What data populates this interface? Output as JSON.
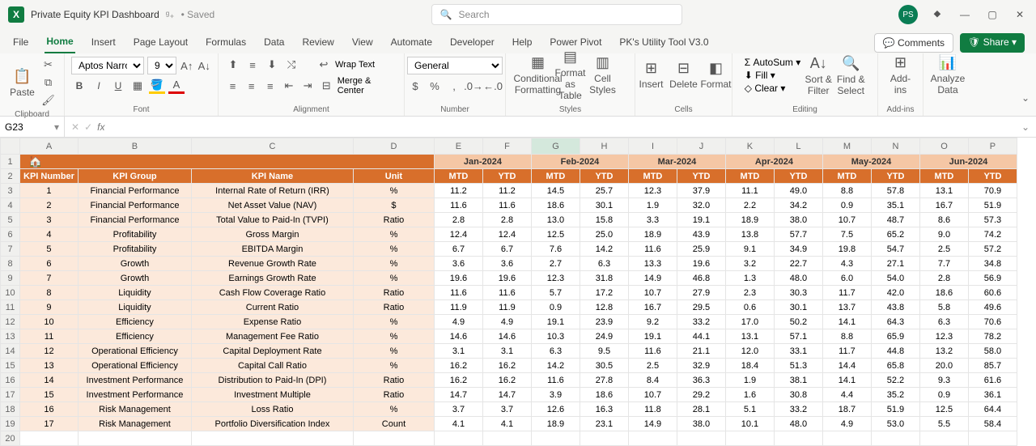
{
  "title": {
    "doc": "Private Equity KPI Dashboard",
    "saved": "• Saved",
    "search_ph": "Search",
    "avatar": "PS"
  },
  "tabs": {
    "items": [
      "File",
      "Home",
      "Insert",
      "Page Layout",
      "Formulas",
      "Data",
      "Review",
      "View",
      "Automate",
      "Developer",
      "Help",
      "Power Pivot",
      "PK's Utility Tool V3.0"
    ],
    "active": 1,
    "comments": "Comments",
    "share": "Share"
  },
  "ribbon": {
    "clipboard": "Clipboard",
    "font": "Font",
    "alignment": "Alignment",
    "number": "Number",
    "styles": "Styles",
    "cells": "Cells",
    "editing": "Editing",
    "addins": "Add-ins",
    "analyze": "Analyze Data",
    "font_name": "Aptos Narrow",
    "font_size": "9",
    "wrap": "Wrap Text",
    "merge": "Merge & Center",
    "num_fmt": "General",
    "cond": "Conditional Formatting",
    "fmt_table": "Format as Table",
    "cell_styles": "Cell Styles",
    "insert": "Insert",
    "delete": "Delete",
    "format": "Format",
    "autosum": "AutoSum",
    "fill": "Fill",
    "clear": "Clear",
    "sort": "Sort & Filter",
    "find": "Find & Select",
    "addins_btn": "Add-ins",
    "analyze_btn": "Analyze Data"
  },
  "fbar": {
    "cell": "G23"
  },
  "cols": [
    "A",
    "B",
    "C",
    "D",
    "E",
    "F",
    "G",
    "H",
    "I",
    "J",
    "K",
    "L",
    "M",
    "N",
    "O",
    "P"
  ],
  "months": [
    "Jan-2024",
    "Feb-2024",
    "Mar-2024",
    "Apr-2024",
    "May-2024",
    "Jun-2024"
  ],
  "hdr": {
    "num": "KPI Number",
    "grp": "KPI Group",
    "name": "KPI Name",
    "unit": "Unit",
    "mtd": "MTD",
    "ytd": "YTD"
  },
  "rows": [
    {
      "n": "1",
      "g": "Financial Performance",
      "k": "Internal Rate of Return (IRR)",
      "u": "%",
      "v": [
        "11.2",
        "11.2",
        "14.5",
        "25.7",
        "12.3",
        "37.9",
        "11.1",
        "49.0",
        "8.8",
        "57.8",
        "13.1",
        "70.9"
      ]
    },
    {
      "n": "2",
      "g": "Financial Performance",
      "k": "Net Asset Value (NAV)",
      "u": "$",
      "v": [
        "11.6",
        "11.6",
        "18.6",
        "30.1",
        "1.9",
        "32.0",
        "2.2",
        "34.2",
        "0.9",
        "35.1",
        "16.7",
        "51.9"
      ]
    },
    {
      "n": "3",
      "g": "Financial Performance",
      "k": "Total Value to Paid-In (TVPI)",
      "u": "Ratio",
      "v": [
        "2.8",
        "2.8",
        "13.0",
        "15.8",
        "3.3",
        "19.1",
        "18.9",
        "38.0",
        "10.7",
        "48.7",
        "8.6",
        "57.3"
      ]
    },
    {
      "n": "4",
      "g": "Profitability",
      "k": "Gross Margin",
      "u": "%",
      "v": [
        "12.4",
        "12.4",
        "12.5",
        "25.0",
        "18.9",
        "43.9",
        "13.8",
        "57.7",
        "7.5",
        "65.2",
        "9.0",
        "74.2"
      ]
    },
    {
      "n": "5",
      "g": "Profitability",
      "k": "EBITDA Margin",
      "u": "%",
      "v": [
        "6.7",
        "6.7",
        "7.6",
        "14.2",
        "11.6",
        "25.9",
        "9.1",
        "34.9",
        "19.8",
        "54.7",
        "2.5",
        "57.2"
      ]
    },
    {
      "n": "6",
      "g": "Growth",
      "k": "Revenue Growth Rate",
      "u": "%",
      "v": [
        "3.6",
        "3.6",
        "2.7",
        "6.3",
        "13.3",
        "19.6",
        "3.2",
        "22.7",
        "4.3",
        "27.1",
        "7.7",
        "34.8"
      ]
    },
    {
      "n": "7",
      "g": "Growth",
      "k": "Earnings Growth Rate",
      "u": "%",
      "v": [
        "19.6",
        "19.6",
        "12.3",
        "31.8",
        "14.9",
        "46.8",
        "1.3",
        "48.0",
        "6.0",
        "54.0",
        "2.8",
        "56.9"
      ]
    },
    {
      "n": "8",
      "g": "Liquidity",
      "k": "Cash Flow Coverage Ratio",
      "u": "Ratio",
      "v": [
        "11.6",
        "11.6",
        "5.7",
        "17.2",
        "10.7",
        "27.9",
        "2.3",
        "30.3",
        "11.7",
        "42.0",
        "18.6",
        "60.6"
      ]
    },
    {
      "n": "9",
      "g": "Liquidity",
      "k": "Current Ratio",
      "u": "Ratio",
      "v": [
        "11.9",
        "11.9",
        "0.9",
        "12.8",
        "16.7",
        "29.5",
        "0.6",
        "30.1",
        "13.7",
        "43.8",
        "5.8",
        "49.6"
      ]
    },
    {
      "n": "10",
      "g": "Efficiency",
      "k": "Expense Ratio",
      "u": "%",
      "v": [
        "4.9",
        "4.9",
        "19.1",
        "23.9",
        "9.2",
        "33.2",
        "17.0",
        "50.2",
        "14.1",
        "64.3",
        "6.3",
        "70.6"
      ]
    },
    {
      "n": "11",
      "g": "Efficiency",
      "k": "Management Fee Ratio",
      "u": "%",
      "v": [
        "14.6",
        "14.6",
        "10.3",
        "24.9",
        "19.1",
        "44.1",
        "13.1",
        "57.1",
        "8.8",
        "65.9",
        "12.3",
        "78.2"
      ]
    },
    {
      "n": "12",
      "g": "Operational Efficiency",
      "k": "Capital Deployment Rate",
      "u": "%",
      "v": [
        "3.1",
        "3.1",
        "6.3",
        "9.5",
        "11.6",
        "21.1",
        "12.0",
        "33.1",
        "11.7",
        "44.8",
        "13.2",
        "58.0"
      ]
    },
    {
      "n": "13",
      "g": "Operational Efficiency",
      "k": "Capital Call Ratio",
      "u": "%",
      "v": [
        "16.2",
        "16.2",
        "14.2",
        "30.5",
        "2.5",
        "32.9",
        "18.4",
        "51.3",
        "14.4",
        "65.8",
        "20.0",
        "85.7"
      ]
    },
    {
      "n": "14",
      "g": "Investment Performance",
      "k": "Distribution to Paid-In (DPI)",
      "u": "Ratio",
      "v": [
        "16.2",
        "16.2",
        "11.6",
        "27.8",
        "8.4",
        "36.3",
        "1.9",
        "38.1",
        "14.1",
        "52.2",
        "9.3",
        "61.6"
      ]
    },
    {
      "n": "15",
      "g": "Investment Performance",
      "k": "Investment Multiple",
      "u": "Ratio",
      "v": [
        "14.7",
        "14.7",
        "3.9",
        "18.6",
        "10.7",
        "29.2",
        "1.6",
        "30.8",
        "4.4",
        "35.2",
        "0.9",
        "36.1"
      ]
    },
    {
      "n": "16",
      "g": "Risk Management",
      "k": "Loss Ratio",
      "u": "%",
      "v": [
        "3.7",
        "3.7",
        "12.6",
        "16.3",
        "11.8",
        "28.1",
        "5.1",
        "33.2",
        "18.7",
        "51.9",
        "12.5",
        "64.4"
      ]
    },
    {
      "n": "17",
      "g": "Risk Management",
      "k": "Portfolio Diversification Index",
      "u": "Count",
      "v": [
        "4.1",
        "4.1",
        "18.9",
        "23.1",
        "14.9",
        "38.0",
        "10.1",
        "48.0",
        "4.9",
        "53.0",
        "5.5",
        "58.4"
      ]
    }
  ]
}
